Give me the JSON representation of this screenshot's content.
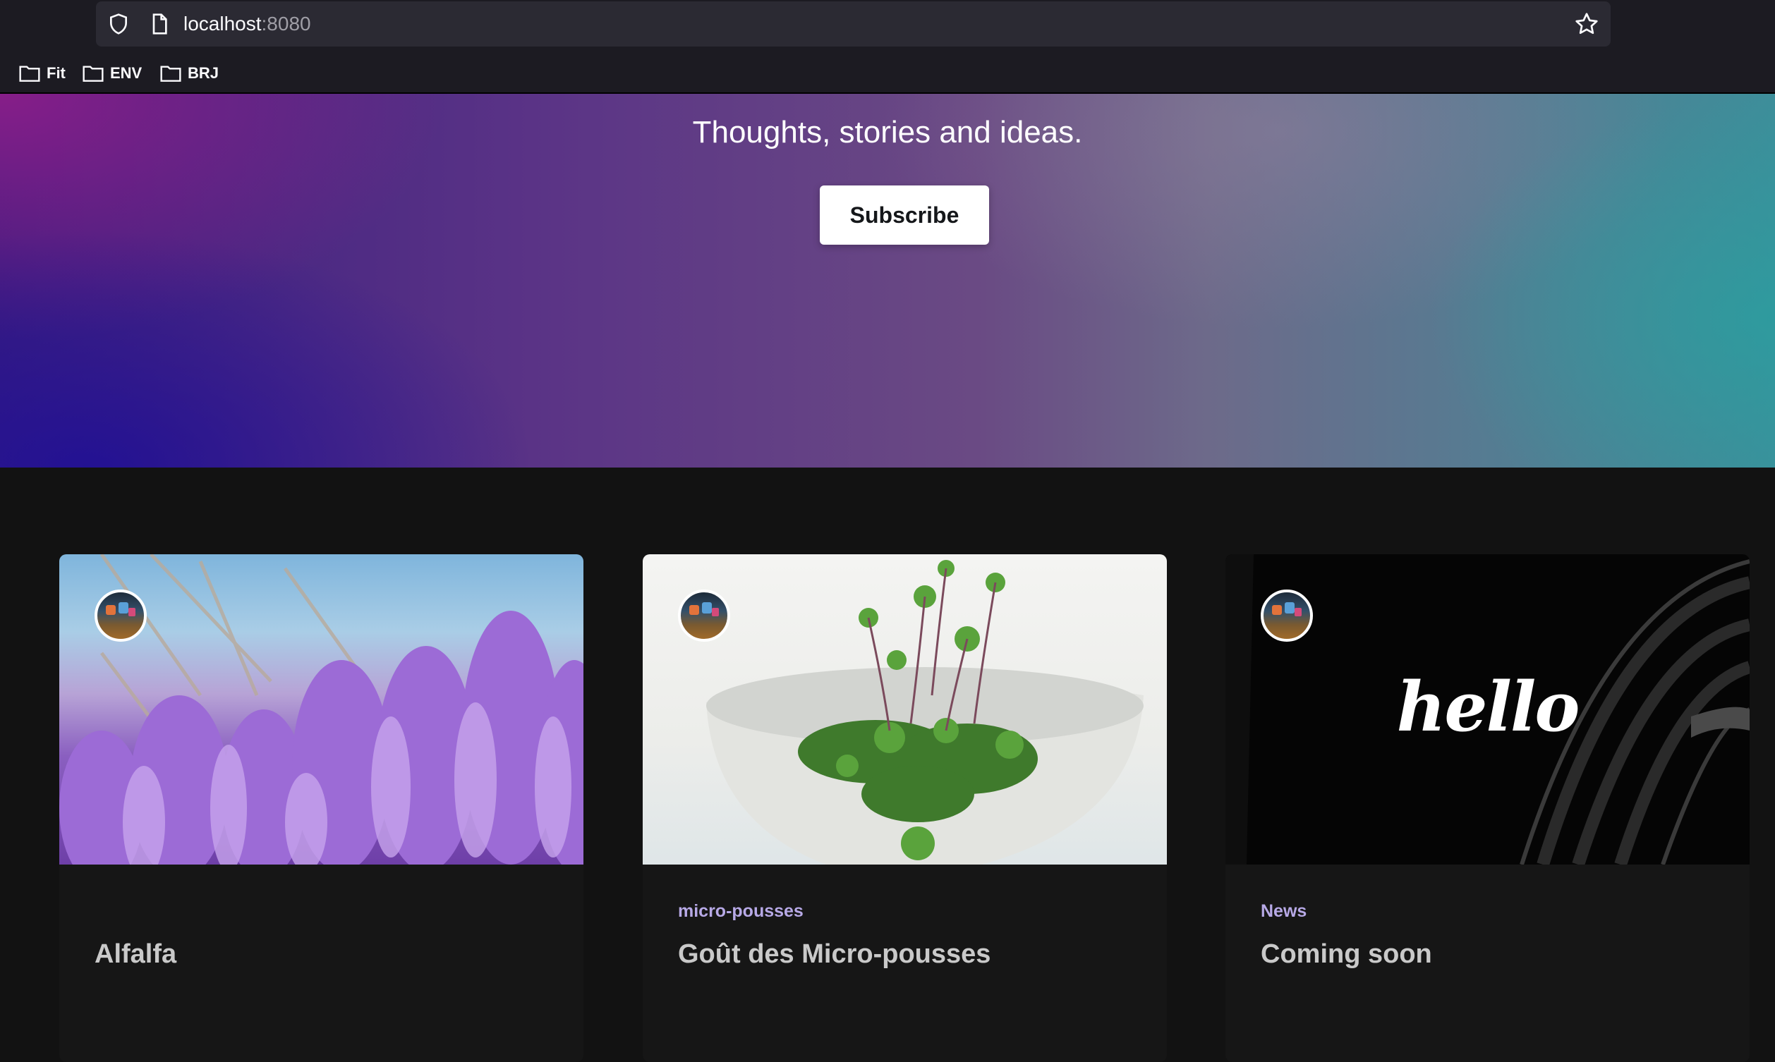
{
  "browser": {
    "url_host": "localhost",
    "url_port": ":8080",
    "icons": {
      "shield": "shield-icon",
      "page": "page-icon",
      "bookmark_star": "star-icon"
    },
    "bookmarks": [
      {
        "label": "Fit",
        "icon": "folder-icon"
      },
      {
        "label": "ENV",
        "icon": "folder-icon"
      },
      {
        "label": "BRJ",
        "icon": "folder-icon"
      }
    ]
  },
  "hero": {
    "tagline": "Thoughts, stories and ideas.",
    "subscribe_label": "Subscribe"
  },
  "posts": [
    {
      "tag": "",
      "title": "Alfalfa",
      "image": "lavender-flowers"
    },
    {
      "tag": "micro-pousses",
      "title": "Goût des Micro-pousses",
      "image": "microgreens-bowl"
    },
    {
      "tag": "News",
      "title": "Coming soon",
      "image": "hello-dark",
      "image_text": "hello"
    }
  ],
  "colors": {
    "page_bg": "#121212",
    "card_bg": "#161616",
    "tag": "#b7a9e6",
    "title": "#c9c9c9",
    "hero_gradient": [
      "#3a1d7f",
      "#6a4a84",
      "#3d8e9a"
    ]
  }
}
